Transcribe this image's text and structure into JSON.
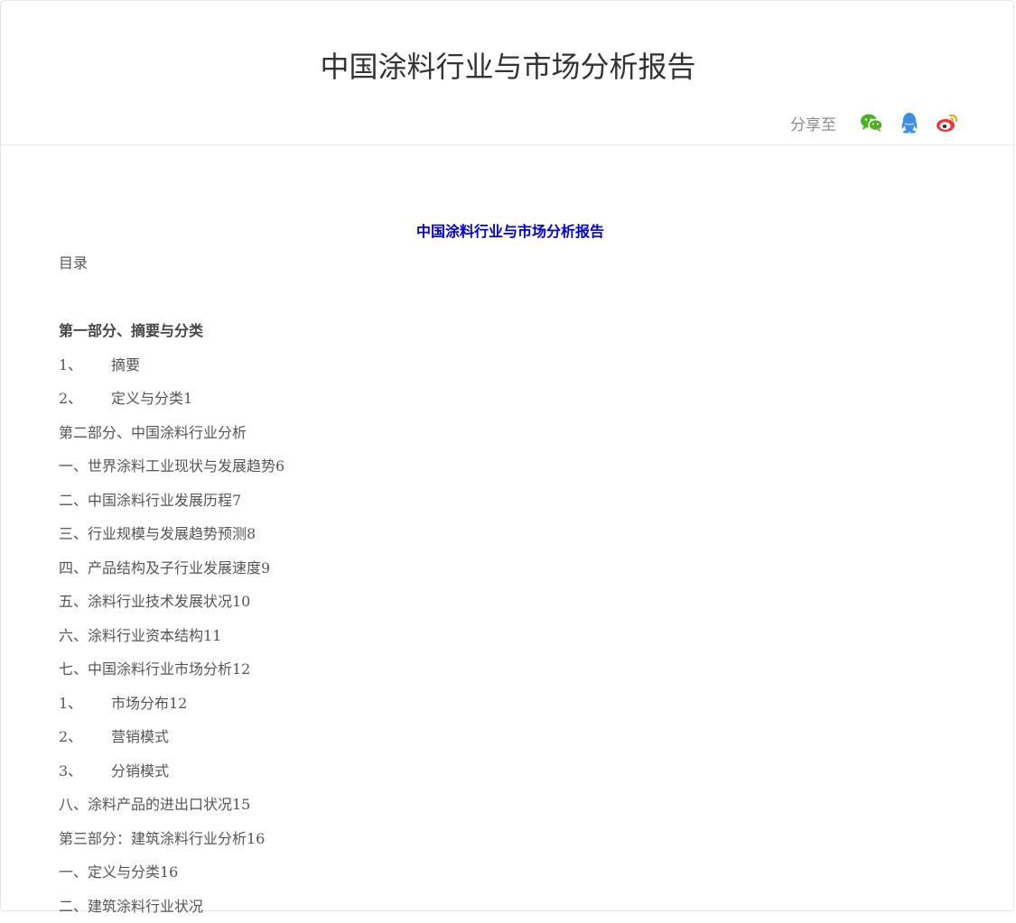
{
  "header": {
    "title": "中国涂料行业与市场分析报告",
    "share_label": "分享至",
    "share_icons": [
      {
        "name": "wechat-icon",
        "color": "#4caf25"
      },
      {
        "name": "qq-icon",
        "color": "#3d8fe6"
      },
      {
        "name": "weibo-icon",
        "color": "#e6393e"
      }
    ]
  },
  "content": {
    "center_title": "中国涂料行业与市场分析报告",
    "toc_label": "目录",
    "lines": [
      {
        "text": "第一部分、摘要与分类",
        "bold": true
      },
      {
        "num": "1、",
        "text": "摘要"
      },
      {
        "num": "2、",
        "text": "定义与分类1"
      },
      {
        "text": "第二部分、中国涂料行业分析"
      },
      {
        "text": "一、世界涂料工业现状与发展趋势6"
      },
      {
        "text": "二、中国涂料行业发展历程7"
      },
      {
        "text": "三、行业规模与发展趋势预测8"
      },
      {
        "text": "四、产品结构及子行业发展速度9"
      },
      {
        "text": "五、涂料行业技术发展状况10"
      },
      {
        "text": "六、涂料行业资本结构11"
      },
      {
        "text": "七、中国涂料行业市场分析12"
      },
      {
        "num": "1、",
        "text": "市场分布12"
      },
      {
        "num": "2、",
        "text": "营销模式"
      },
      {
        "num": "3、",
        "text": "分销模式"
      },
      {
        "text": "八、涂料产品的进出口状况15"
      },
      {
        "text": "第三部分：建筑涂料行业分析16"
      },
      {
        "text": "一、定义与分类16"
      },
      {
        "text": "二、建筑涂料行业状况"
      }
    ]
  }
}
